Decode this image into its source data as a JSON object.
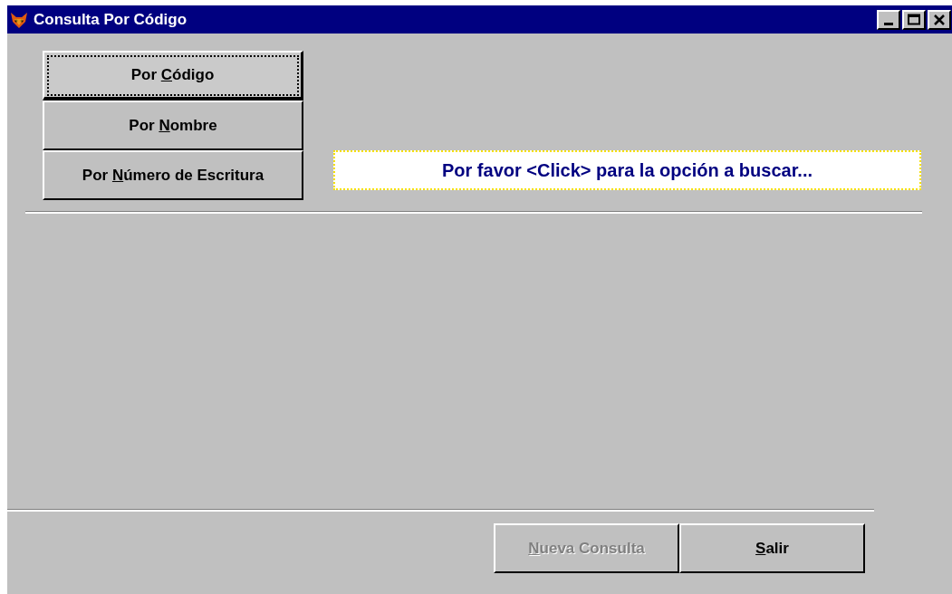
{
  "window": {
    "title": "Consulta Por Código"
  },
  "option_buttons": [
    {
      "before": "Por ",
      "accel": "C",
      "after": "ódigo",
      "focused": true
    },
    {
      "before": "Por ",
      "accel": "N",
      "after": "ombre",
      "focused": false
    },
    {
      "before": "Por ",
      "accel": "N",
      "after": "úmero de Escritura",
      "focused": false
    }
  ],
  "message": "Por favor <Click> para la opción a buscar...",
  "action_buttons": [
    {
      "accel": "N",
      "after": "ueva Consulta",
      "disabled": true
    },
    {
      "accel": "S",
      "after": "alir",
      "disabled": false
    }
  ]
}
